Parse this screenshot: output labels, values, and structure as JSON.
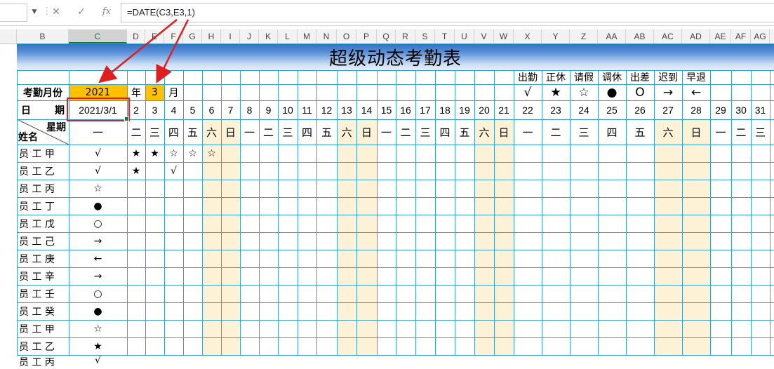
{
  "formula_bar": {
    "cancel_icon": "✕",
    "enter_icon": "✓",
    "fx_icon": "fx",
    "formula": "=DATE(C3,E3,1)"
  },
  "columns": [
    "B",
    "C",
    "D",
    "E",
    "F",
    "G",
    "H",
    "I",
    "J",
    "K",
    "L",
    "M",
    "N",
    "O",
    "P",
    "Q",
    "R",
    "S",
    "T",
    "U",
    "V",
    "W",
    "X",
    "Y",
    "Z",
    "AA",
    "AB",
    "AC",
    "AD",
    "AE",
    "AF",
    "AG"
  ],
  "selected_column": "C",
  "title": "超级动态考勤表",
  "legend": {
    "labels": [
      "出勤",
      "正休",
      "请假",
      "调休",
      "出差",
      "迟到",
      "早退"
    ],
    "symbols": [
      "√",
      "★",
      "☆",
      "●",
      "O",
      "→",
      "←"
    ]
  },
  "month_row": {
    "label": "考勤月份",
    "year": "2021",
    "year_unit": "年",
    "month": "3",
    "month_unit": "月"
  },
  "date_row": {
    "label_left": "日",
    "label_right": "期",
    "first_date": "2021/3/1",
    "days": [
      "2",
      "3",
      "4",
      "5",
      "6",
      "7",
      "8",
      "9",
      "10",
      "11",
      "12",
      "13",
      "14",
      "15",
      "16",
      "17",
      "18",
      "19",
      "20",
      "21",
      "22",
      "23",
      "24",
      "25",
      "26",
      "27",
      "28",
      "29",
      "30",
      "31"
    ]
  },
  "weekday_row": {
    "header_top": "星期",
    "header_bottom": "姓名",
    "weekdays": [
      "一",
      "二",
      "三",
      "四",
      "五",
      "六",
      "日",
      "一",
      "二",
      "三",
      "四",
      "五",
      "六",
      "日",
      "一",
      "二",
      "三",
      "四",
      "五",
      "六",
      "日",
      "一",
      "二",
      "三",
      "四",
      "五",
      "六",
      "日",
      "一",
      "二",
      "三"
    ]
  },
  "employees": [
    {
      "name": "员 工 甲",
      "marks": [
        "√",
        "★",
        "★",
        "☆",
        "☆",
        "☆"
      ]
    },
    {
      "name": "员 工 乙",
      "marks": [
        "√",
        "★",
        "",
        "√"
      ]
    },
    {
      "name": "员 工 丙",
      "marks": [
        "☆"
      ]
    },
    {
      "name": "员 工 丁",
      "marks": [
        "●"
      ]
    },
    {
      "name": "员 工 戊",
      "marks": [
        "○"
      ]
    },
    {
      "name": "员 工 己",
      "marks": [
        "→"
      ]
    },
    {
      "name": "员 工 庚",
      "marks": [
        "←"
      ]
    },
    {
      "name": "员 工 辛",
      "marks": [
        "→"
      ]
    },
    {
      "name": "员 工 壬",
      "marks": [
        "○"
      ]
    },
    {
      "name": "员 工 癸",
      "marks": [
        "●"
      ]
    },
    {
      "name": "员 工 甲",
      "marks": [
        "☆"
      ]
    },
    {
      "name": "员 工 乙",
      "marks": [
        "★"
      ]
    },
    {
      "name": "员 工 丙",
      "marks": [
        "√"
      ]
    }
  ],
  "colors": {
    "grid": "#36a4cf",
    "highlight": "#ffc000",
    "weekend": "#fdf1d6",
    "annotation": "#e01e1e",
    "title_gradient_top": "#2f6fc3"
  }
}
